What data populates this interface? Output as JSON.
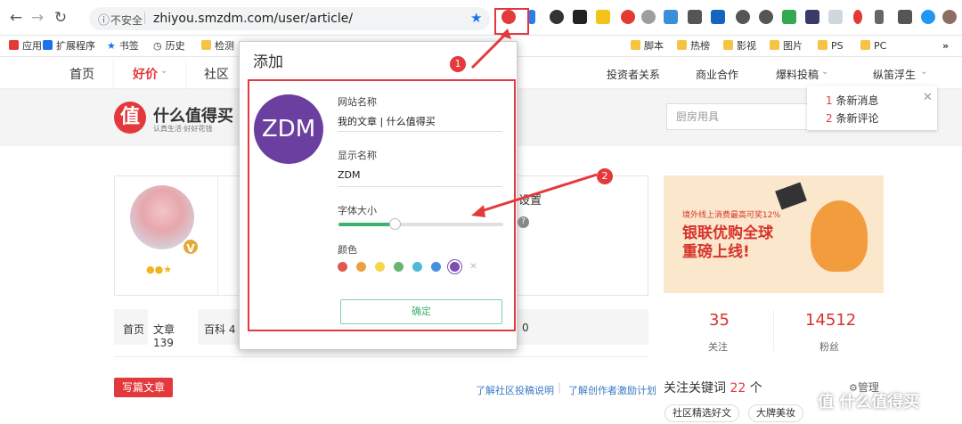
{
  "browser": {
    "insecure": "不安全",
    "url": "zhiyou.smzdm.com/user/article/"
  },
  "bookmarks": [
    "应用",
    "扩展程序",
    "书签",
    "历史",
    "检测",
    "脚本",
    "热榜",
    "影视",
    "图片",
    "PS",
    "PC"
  ],
  "site_nav": {
    "home": "首页",
    "deals": "好价",
    "community": "社区",
    "investor": "投资者关系",
    "business": "商业合作",
    "submit": "爆料投稿",
    "user": "纵笛浮生"
  },
  "header": {
    "logo_char": "值",
    "brand": "什么值得买",
    "slogan": "认真生活·好好花钱",
    "search_placeholder": "厨房用具"
  },
  "notices": {
    "msg_count": "1",
    "msg_text": "条新消息",
    "comment_count": "2",
    "comment_text": "条新评论"
  },
  "profile": {
    "settings": "设置"
  },
  "tabs": {
    "home": "首页",
    "article": "文章 139",
    "wiki": "百科 4",
    "last": "0"
  },
  "actions": {
    "write": "写篇文章",
    "link1": "了解社区投稿说明",
    "link2": "了解创作者激励计划"
  },
  "ad": {
    "top": "境外线上消费最高可奖12%",
    "line1": "银联优购全球",
    "line2": "重磅上线!"
  },
  "stats": {
    "follow_num": "35",
    "follow_lbl": "关注",
    "fans_num": "14512",
    "fans_lbl": "粉丝"
  },
  "keywords": {
    "title": "关注关键词",
    "count": "22",
    "unit": "个",
    "manage": "管理",
    "chips": [
      "社区精选好文",
      "大牌美妆"
    ]
  },
  "popup": {
    "title": "添加",
    "avatar_text": "ZDM",
    "site_name_label": "网站名称",
    "site_name_value": "我的文章 | 什么值得买",
    "display_name_label": "显示名称",
    "display_name_value": "ZDM",
    "font_size_label": "字体大小",
    "font_size_value": 0.34,
    "color_label": "颜色",
    "colors": [
      "#e0574f",
      "#eba141",
      "#f2d84b",
      "#6ab56f",
      "#4fb9d5",
      "#4a8fe0",
      "#7b4fb0",
      "#cccccc"
    ],
    "ok": "确定"
  },
  "annotations": {
    "marker1": "1",
    "marker2": "2"
  },
  "watermark": "值 什么值得买"
}
